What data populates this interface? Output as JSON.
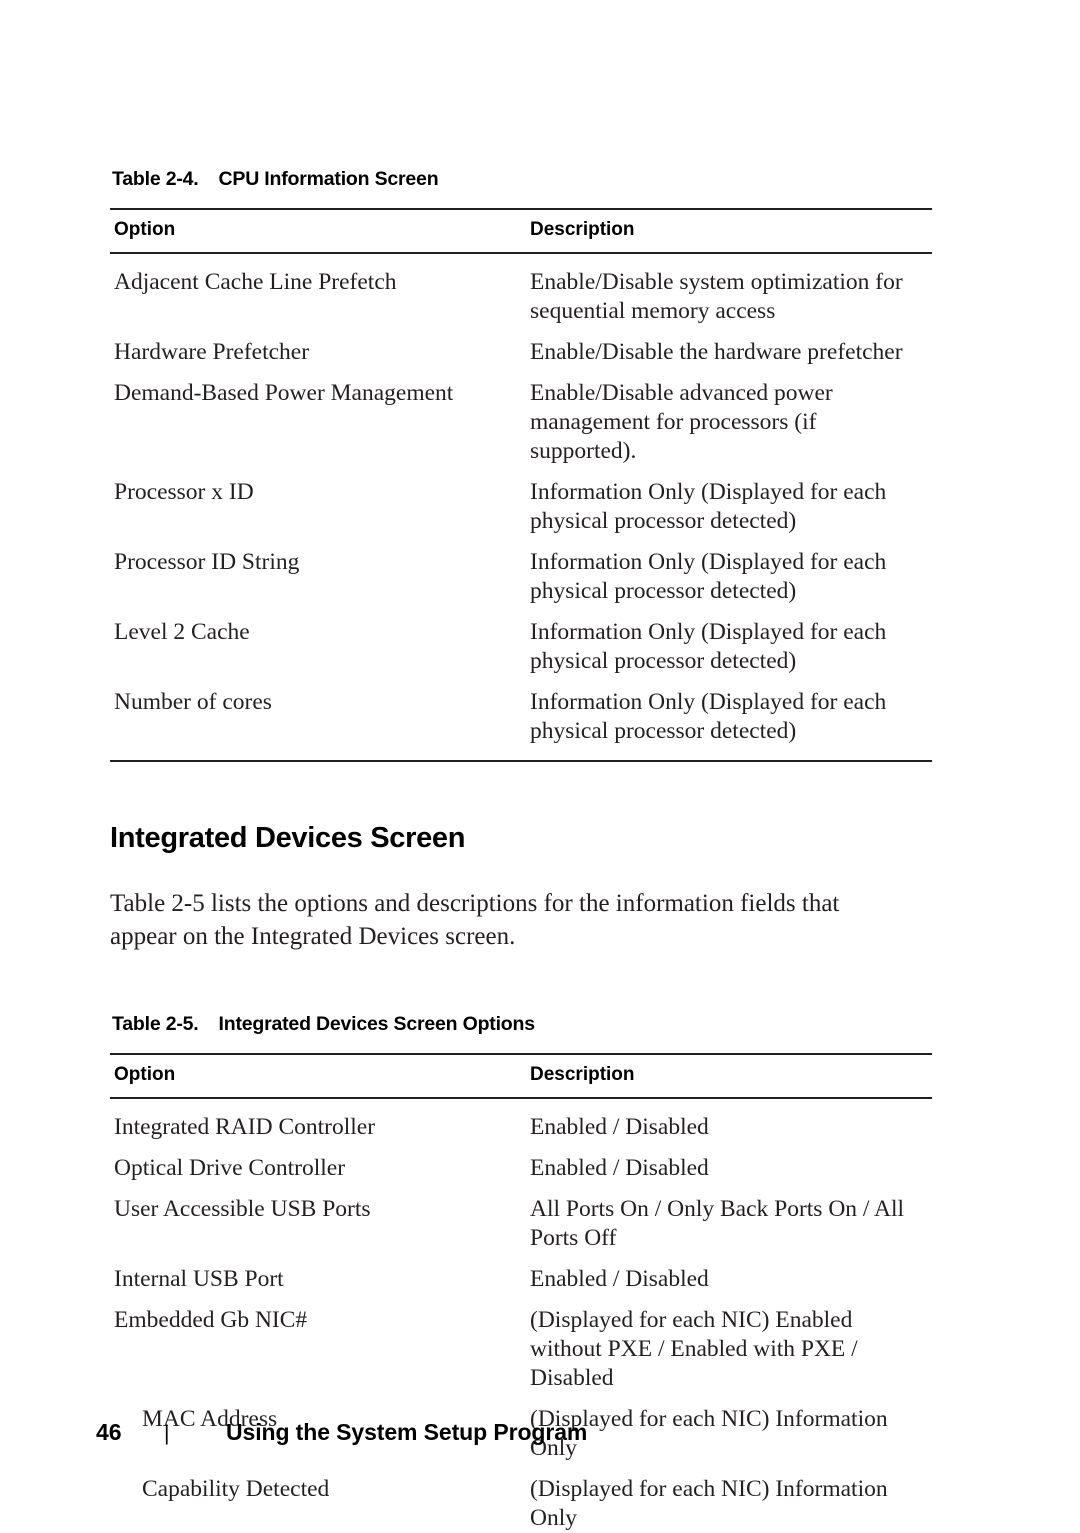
{
  "document": {
    "page_number": "46",
    "footer_separator": "|",
    "footer_title": "Using the System Setup Program"
  },
  "table_cpu": {
    "caption_number": "Table 2-4.",
    "caption_title": "CPU Information Screen",
    "headers": {
      "option": "Option",
      "description": "Description"
    },
    "rows": [
      {
        "option": "Adjacent Cache Line Prefetch",
        "description": "Enable/Disable system optimization for sequential memory access",
        "indent": false
      },
      {
        "option": "Hardware Prefetcher",
        "description": "Enable/Disable the hardware prefetcher",
        "indent": false
      },
      {
        "option": "Demand-Based Power Management",
        "description": "Enable/Disable advanced power management for processors (if supported).",
        "indent": false
      },
      {
        "option": "Processor x ID",
        "description": "Information Only (Displayed for each physical processor detected)",
        "indent": false
      },
      {
        "option": "Processor ID String",
        "description": "Information Only (Displayed for each physical processor detected)",
        "indent": false
      },
      {
        "option": "Level 2 Cache",
        "description": "Information Only (Displayed for each physical processor detected)",
        "indent": false
      },
      {
        "option": "Number of cores",
        "description": "Information Only (Displayed for each physical processor detected)",
        "indent": false
      }
    ]
  },
  "section": {
    "heading": "Integrated Devices Screen",
    "intro": "Table 2-5 lists the options and descriptions for the information fields that appear on the Integrated Devices screen."
  },
  "table_integrated": {
    "caption_number": "Table 2-5.",
    "caption_title": "Integrated Devices Screen Options",
    "headers": {
      "option": "Option",
      "description": "Description"
    },
    "rows": [
      {
        "option": "Integrated RAID Controller",
        "description": "Enabled / Disabled",
        "indent": false
      },
      {
        "option": "Optical Drive Controller",
        "description": "Enabled / Disabled",
        "indent": false
      },
      {
        "option": "User Accessible USB Ports",
        "description": "All Ports On / Only Back Ports On / All Ports Off",
        "indent": false
      },
      {
        "option": "Internal USB Port",
        "description": "Enabled / Disabled",
        "indent": false
      },
      {
        "option": "Embedded Gb NIC#",
        "description": "(Displayed for each NIC) Enabled without PXE / Enabled with PXE / Disabled",
        "indent": false
      },
      {
        "option": "MAC Address",
        "description": "(Displayed for each NIC) Information Only",
        "indent": true
      },
      {
        "option": "Capability Detected",
        "description": "(Displayed for each NIC) Information Only",
        "indent": true
      }
    ]
  }
}
